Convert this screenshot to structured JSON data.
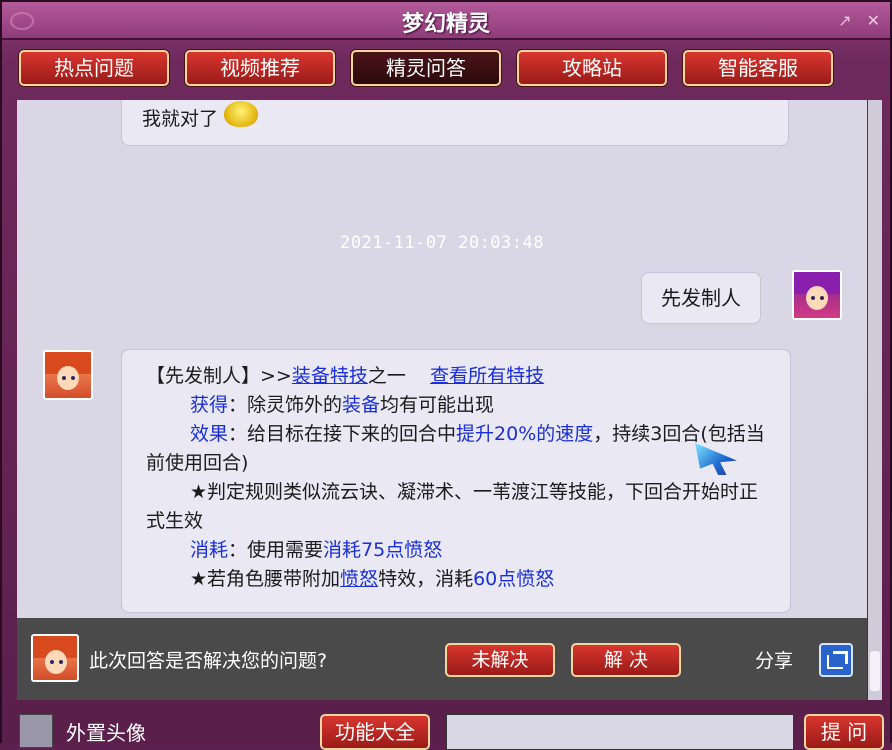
{
  "window": {
    "title": "梦幻精灵"
  },
  "tabs": [
    {
      "label": "热点问题"
    },
    {
      "label": "视频推荐"
    },
    {
      "label": "精灵问答"
    },
    {
      "label": "攻略站"
    },
    {
      "label": "智能客服"
    }
  ],
  "active_tab": "精灵问答",
  "chat": {
    "prev_answer_tail": "我就对了",
    "timestamp": "2021-11-07 20:03:48",
    "user_message": "先发制人",
    "answer": {
      "head_bracket": "【先发制人】",
      "head_arrows": ">>",
      "head_link": "装备特技",
      "head_suffix": "之一",
      "view_all_link": "查看所有特技",
      "obtain_label": "获得",
      "obtain_pre": "：除灵饰外的",
      "obtain_highlight": "装备",
      "obtain_post": "均有可能出现",
      "effect_label": "效果",
      "effect_pre": "：给目标在接下来的回合中",
      "effect_highlight": "提升20%的速度",
      "effect_post": "，持续3回合(包括当前使用回合)",
      "rule_note": "★判定规则类似流云诀、凝滞术、一苇渡江等技能，下回合开始时正式生效",
      "cost_label": "消耗",
      "cost_pre": "：使用需要",
      "cost_highlight": "消耗75点愤怒",
      "belt_pre": "★若角色腰带附加",
      "belt_link": "愤怒",
      "belt_mid": "特效，消耗",
      "belt_highlight": "60点愤怒"
    }
  },
  "feedback": {
    "question": "此次回答是否解决您的问题?",
    "unsolved_label": "未解决",
    "solved_label": "解 决",
    "share_label": "分享"
  },
  "bottom": {
    "ext_avatar_label": "外置头像",
    "functions_label": "功能大全",
    "input_value": "",
    "ask_label": "提 问"
  }
}
